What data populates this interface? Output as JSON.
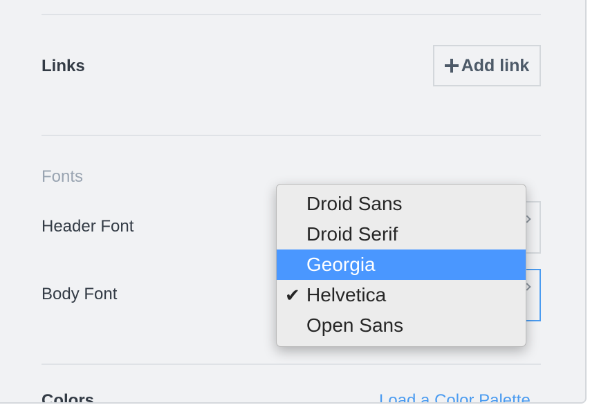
{
  "links": {
    "label": "Links",
    "add_button": "Add link"
  },
  "fonts": {
    "section_title": "Fonts",
    "header_font_label": "Header Font",
    "body_font_label": "Body Font",
    "dropdown": {
      "options": [
        "Droid Sans",
        "Droid Serif",
        "Georgia",
        "Helvetica",
        "Open Sans"
      ],
      "highlighted": "Georgia",
      "selected": "Helvetica"
    }
  },
  "colors": {
    "label": "Colors",
    "palette_link": "Load a Color Palette"
  },
  "icons": {
    "add": "plus-icon",
    "selected": "checkmark-icon",
    "select": "chevron-icon"
  },
  "theme": {
    "accent": "#4a97ff",
    "link": "#4a9bf0",
    "muted": "#99a4b1",
    "text": "#333b45"
  }
}
